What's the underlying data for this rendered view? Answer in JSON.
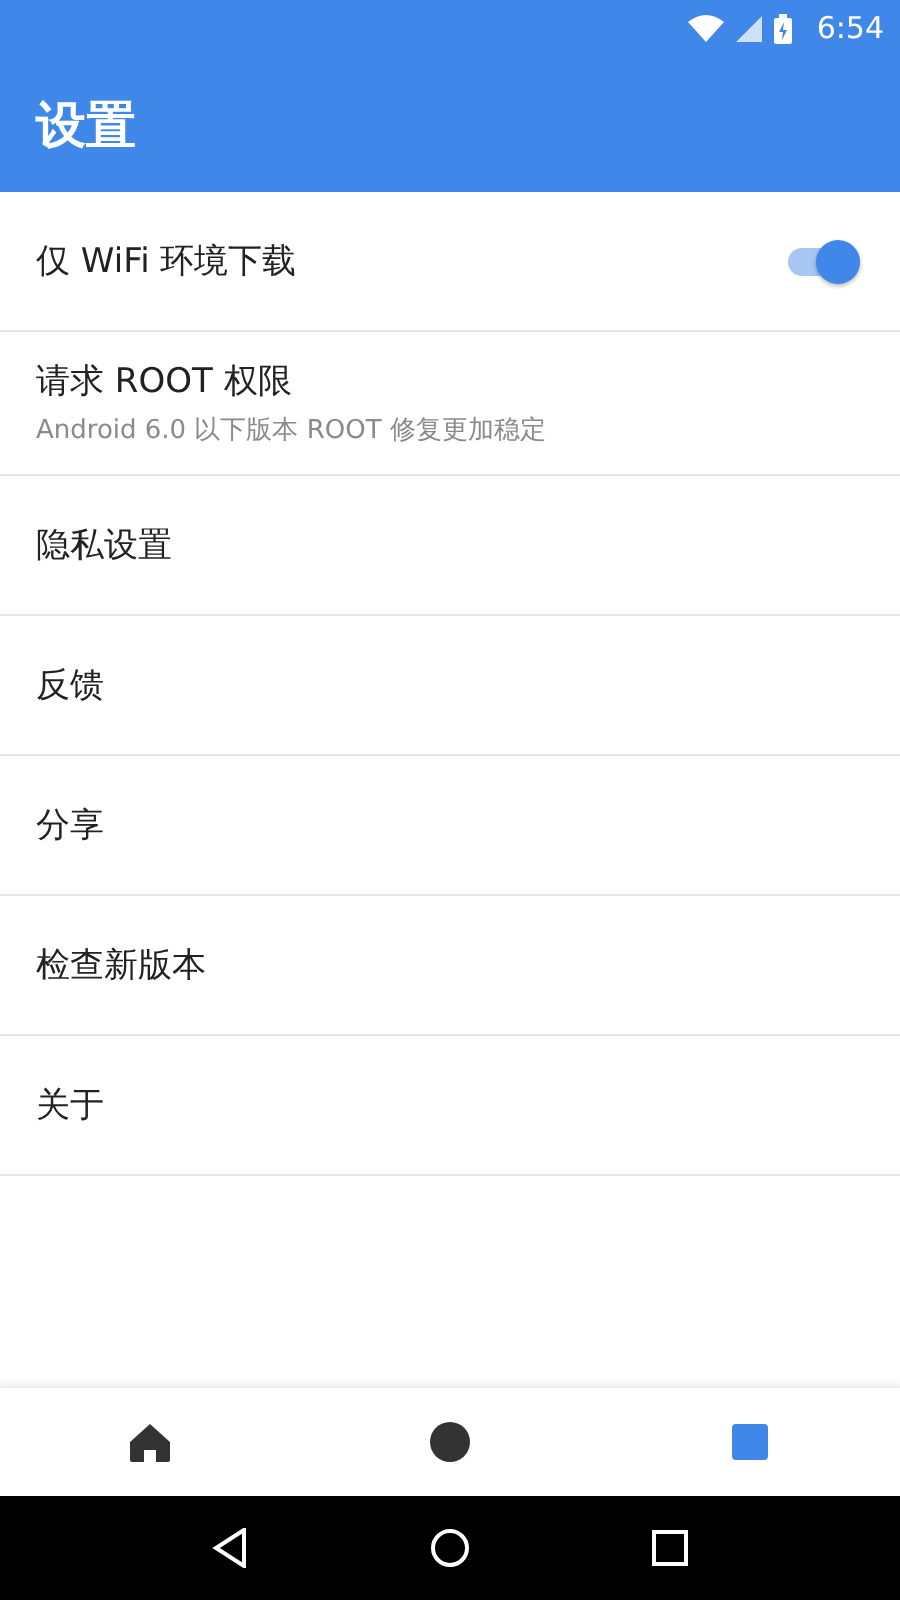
{
  "status_bar": {
    "time": "6:54"
  },
  "app_bar": {
    "title": "设置"
  },
  "settings": [
    {
      "kind": "switch",
      "title": "仅 WiFi 环境下载",
      "on": true
    },
    {
      "kind": "text",
      "title": "请求 ROOT 权限",
      "subtitle": "Android 6.0 以下版本 ROOT 修复更加稳定"
    },
    {
      "kind": "text",
      "title": "隐私设置"
    },
    {
      "kind": "text",
      "title": "反馈"
    },
    {
      "kind": "text",
      "title": "分享"
    },
    {
      "kind": "text",
      "title": "检查新版本"
    },
    {
      "kind": "text",
      "title": "关于"
    }
  ],
  "bottom_nav": [
    {
      "kind": "home",
      "selected": false
    },
    {
      "kind": "circle",
      "selected": false
    },
    {
      "kind": "square",
      "selected": true
    }
  ]
}
